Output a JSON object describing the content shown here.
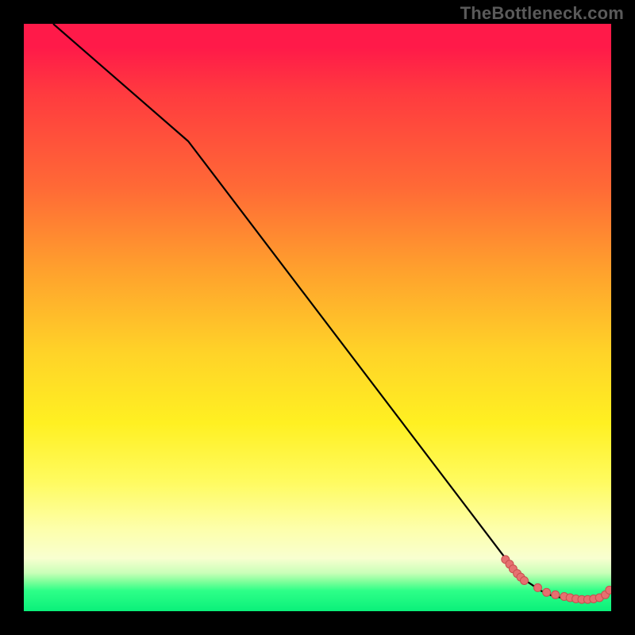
{
  "watermark": "TheBottleneck.com",
  "chart_data": {
    "type": "line",
    "title": "",
    "xlabel": "",
    "ylabel": "",
    "xlim": [
      0,
      100
    ],
    "ylim": [
      0,
      100
    ],
    "series": [
      {
        "name": "curve",
        "x": [
          5,
          28,
          82,
          85,
          88,
          90,
          92,
          94,
          95.5,
          97,
          98.5,
          99.5
        ],
        "values": [
          100,
          80,
          9,
          5.5,
          3.5,
          2.6,
          2.2,
          2.0,
          2.0,
          2.2,
          2.6,
          3.6
        ]
      }
    ],
    "scatter": {
      "name": "markers",
      "x": [
        82,
        82.7,
        83.3,
        84,
        84.6,
        85.2,
        87.5,
        89,
        90.5,
        92,
        93,
        94,
        95,
        96,
        97,
        98,
        99,
        99.7
      ],
      "values": [
        8.8,
        8.0,
        7.2,
        6.4,
        5.8,
        5.2,
        4.0,
        3.2,
        2.8,
        2.5,
        2.3,
        2.1,
        2.0,
        2.0,
        2.1,
        2.3,
        2.8,
        3.6
      ]
    },
    "gradient_stops": [
      {
        "pos": 0,
        "color": "#ff1a49"
      },
      {
        "pos": 12,
        "color": "#ff3b3f"
      },
      {
        "pos": 28,
        "color": "#ff6a36"
      },
      {
        "pos": 42,
        "color": "#ffa12d"
      },
      {
        "pos": 56,
        "color": "#ffd328"
      },
      {
        "pos": 68,
        "color": "#fff022"
      },
      {
        "pos": 86,
        "color": "#fdffab"
      },
      {
        "pos": 95,
        "color": "#7dff9a"
      },
      {
        "pos": 100,
        "color": "#0af07a"
      }
    ],
    "colors": {
      "line": "#000000",
      "marker_fill": "#e67070",
      "marker_stroke": "#c74f4f",
      "background_frame": "#000000",
      "watermark": "#5a5a5a"
    }
  }
}
